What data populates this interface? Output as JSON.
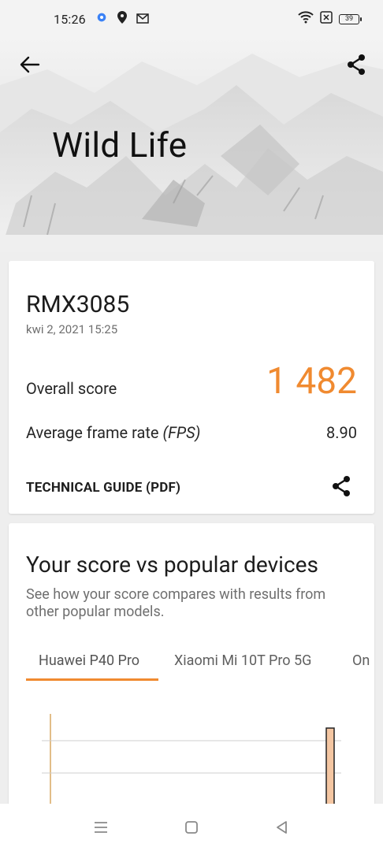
{
  "status_bar": {
    "time": "15:26",
    "battery": "39",
    "icons": [
      "settings-icon",
      "location-icon",
      "gmail-icon",
      "wifi-icon",
      "sim-icon",
      "battery-icon"
    ]
  },
  "header": {
    "title": "Wild Life",
    "back_icon": "arrow-left-icon",
    "share_icon": "share-icon"
  },
  "result": {
    "device_name": "RMX3085",
    "date": "kwi 2, 2021 15:25",
    "overall_label": "Overall score",
    "overall_value": "1 482",
    "fps_label": "Average frame rate",
    "fps_unit": "(FPS)",
    "fps_value": "8.90",
    "guide_label": "TECHNICAL GUIDE (PDF)"
  },
  "compare": {
    "title": "Your score vs popular devices",
    "description": "See how your score compares with results from other popular models.",
    "tabs": [
      "Huawei P40 Pro",
      "Xiaomi Mi 10T Pro 5G",
      "On"
    ],
    "active_tab": 0
  },
  "colors": {
    "accent": "#f08a30",
    "bar_fill": "#f4c6a2"
  },
  "nav": [
    "menu-icon",
    "home-icon",
    "back-icon"
  ]
}
